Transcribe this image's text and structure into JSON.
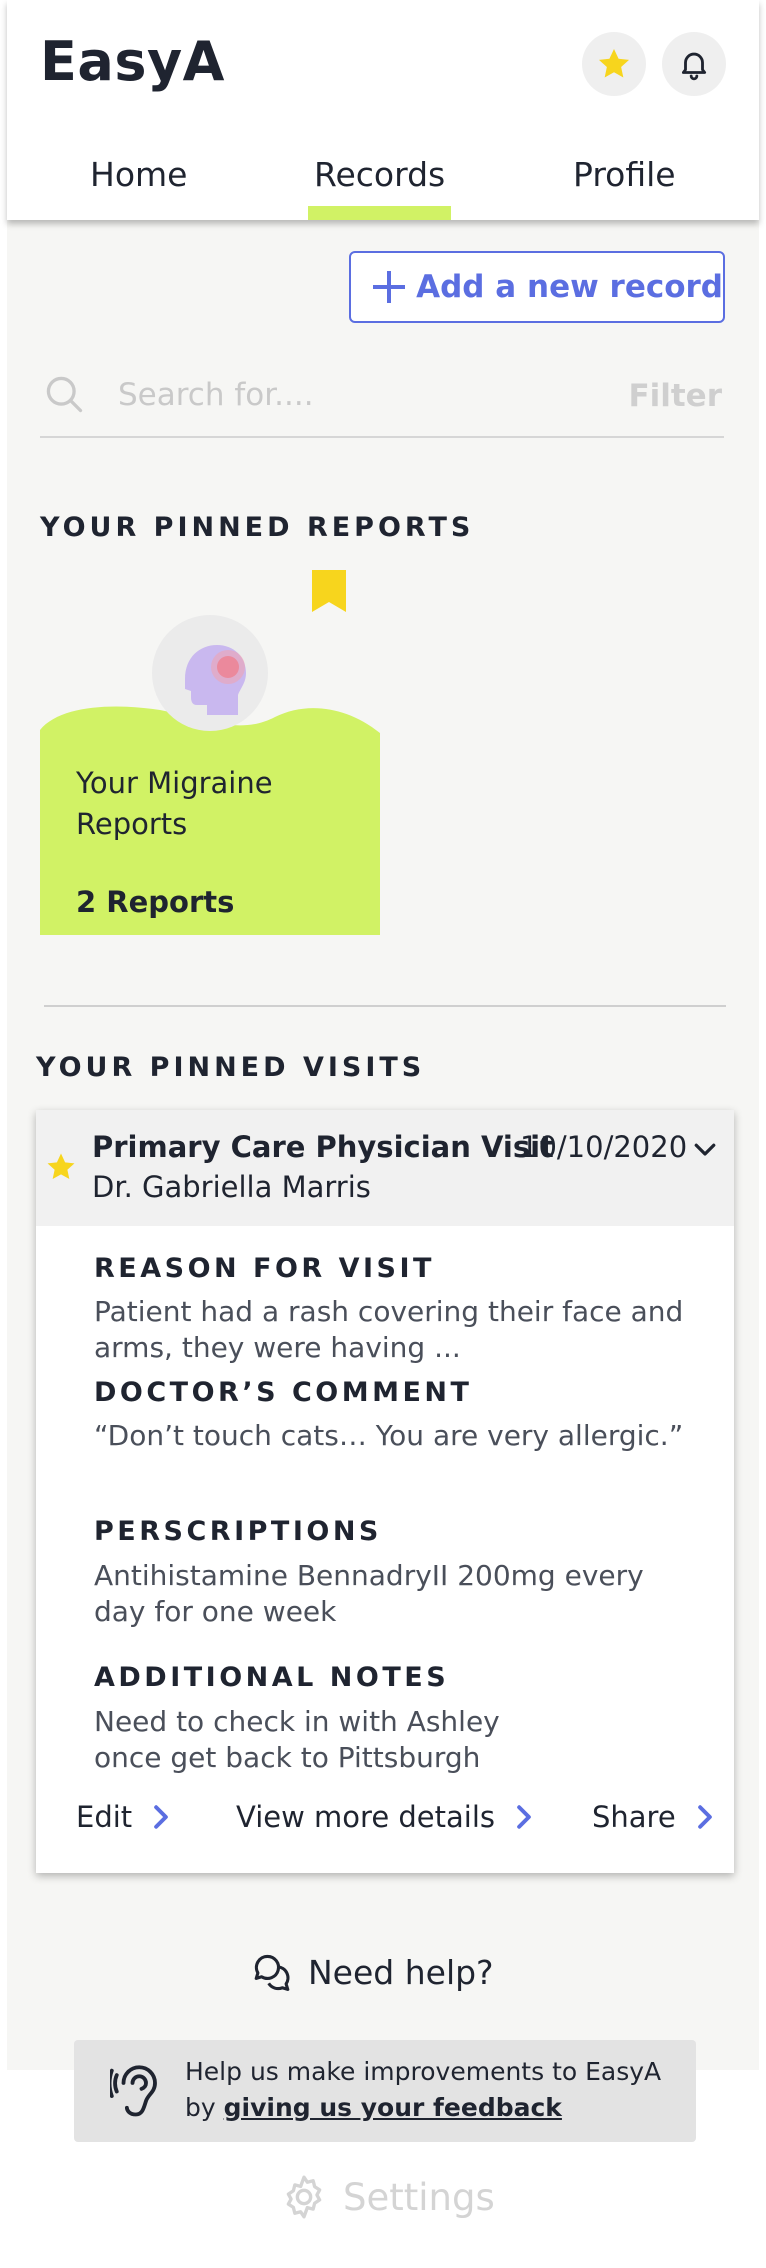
{
  "header": {
    "app_name": "EasyA",
    "favorites_icon": "star-icon",
    "notifications_icon": "bell-icon"
  },
  "tabs": [
    {
      "label": "Home",
      "active": false
    },
    {
      "label": "Records",
      "active": true
    },
    {
      "label": "Profile",
      "active": false
    }
  ],
  "add_record": {
    "label": "Add a new record",
    "icon": "plus-icon"
  },
  "search": {
    "placeholder": "Search for....",
    "value": "",
    "filter_label": "Filter"
  },
  "pinned_reports": {
    "title": "YOUR PINNED REPORTS",
    "items": [
      {
        "title": "Your Migraine Reports",
        "count": "2 Reports",
        "icon": "migraine-head-icon",
        "bookmark_icon": "bookmark-icon"
      }
    ]
  },
  "pinned_visits": {
    "title": "YOUR PINNED VISITS",
    "items": [
      {
        "title": "Primary Care Physician Visit",
        "date": "10/10/2020",
        "doctor": "Dr. Gabriella Marris",
        "reason_label": "REASON FOR VISIT",
        "reason": "Patient had a rash covering their face and arms, they were having ...",
        "comment_label": "DOCTOR’S COMMENT",
        "comment": "“Don’t touch cats… You are very allergic.”",
        "prescriptions_label": "PERSCRIPTIONS",
        "prescriptions": "Antihistamine BennadryII 200mg every day for one week",
        "notes_label": "ADDITIONAL NOTES",
        "notes": "Need to check in with Ashley once get back to Pittsburgh",
        "actions": {
          "edit": "Edit",
          "details": "View more details",
          "share": "Share"
        }
      }
    ]
  },
  "help": {
    "label": "Need help?",
    "icon": "chat-bubbles-icon"
  },
  "feedback": {
    "prefix": "Help us make improvements to EasyA by ",
    "link": "giving us your feedback",
    "icon": "ear-icon"
  },
  "settings": {
    "label": "Settings",
    "icon": "gear-icon"
  },
  "colors": {
    "accent_green": "#d1f265",
    "accent_blue": "#5b6ee1",
    "star_yellow": "#f7d51d",
    "dark_text": "#1f2430"
  }
}
